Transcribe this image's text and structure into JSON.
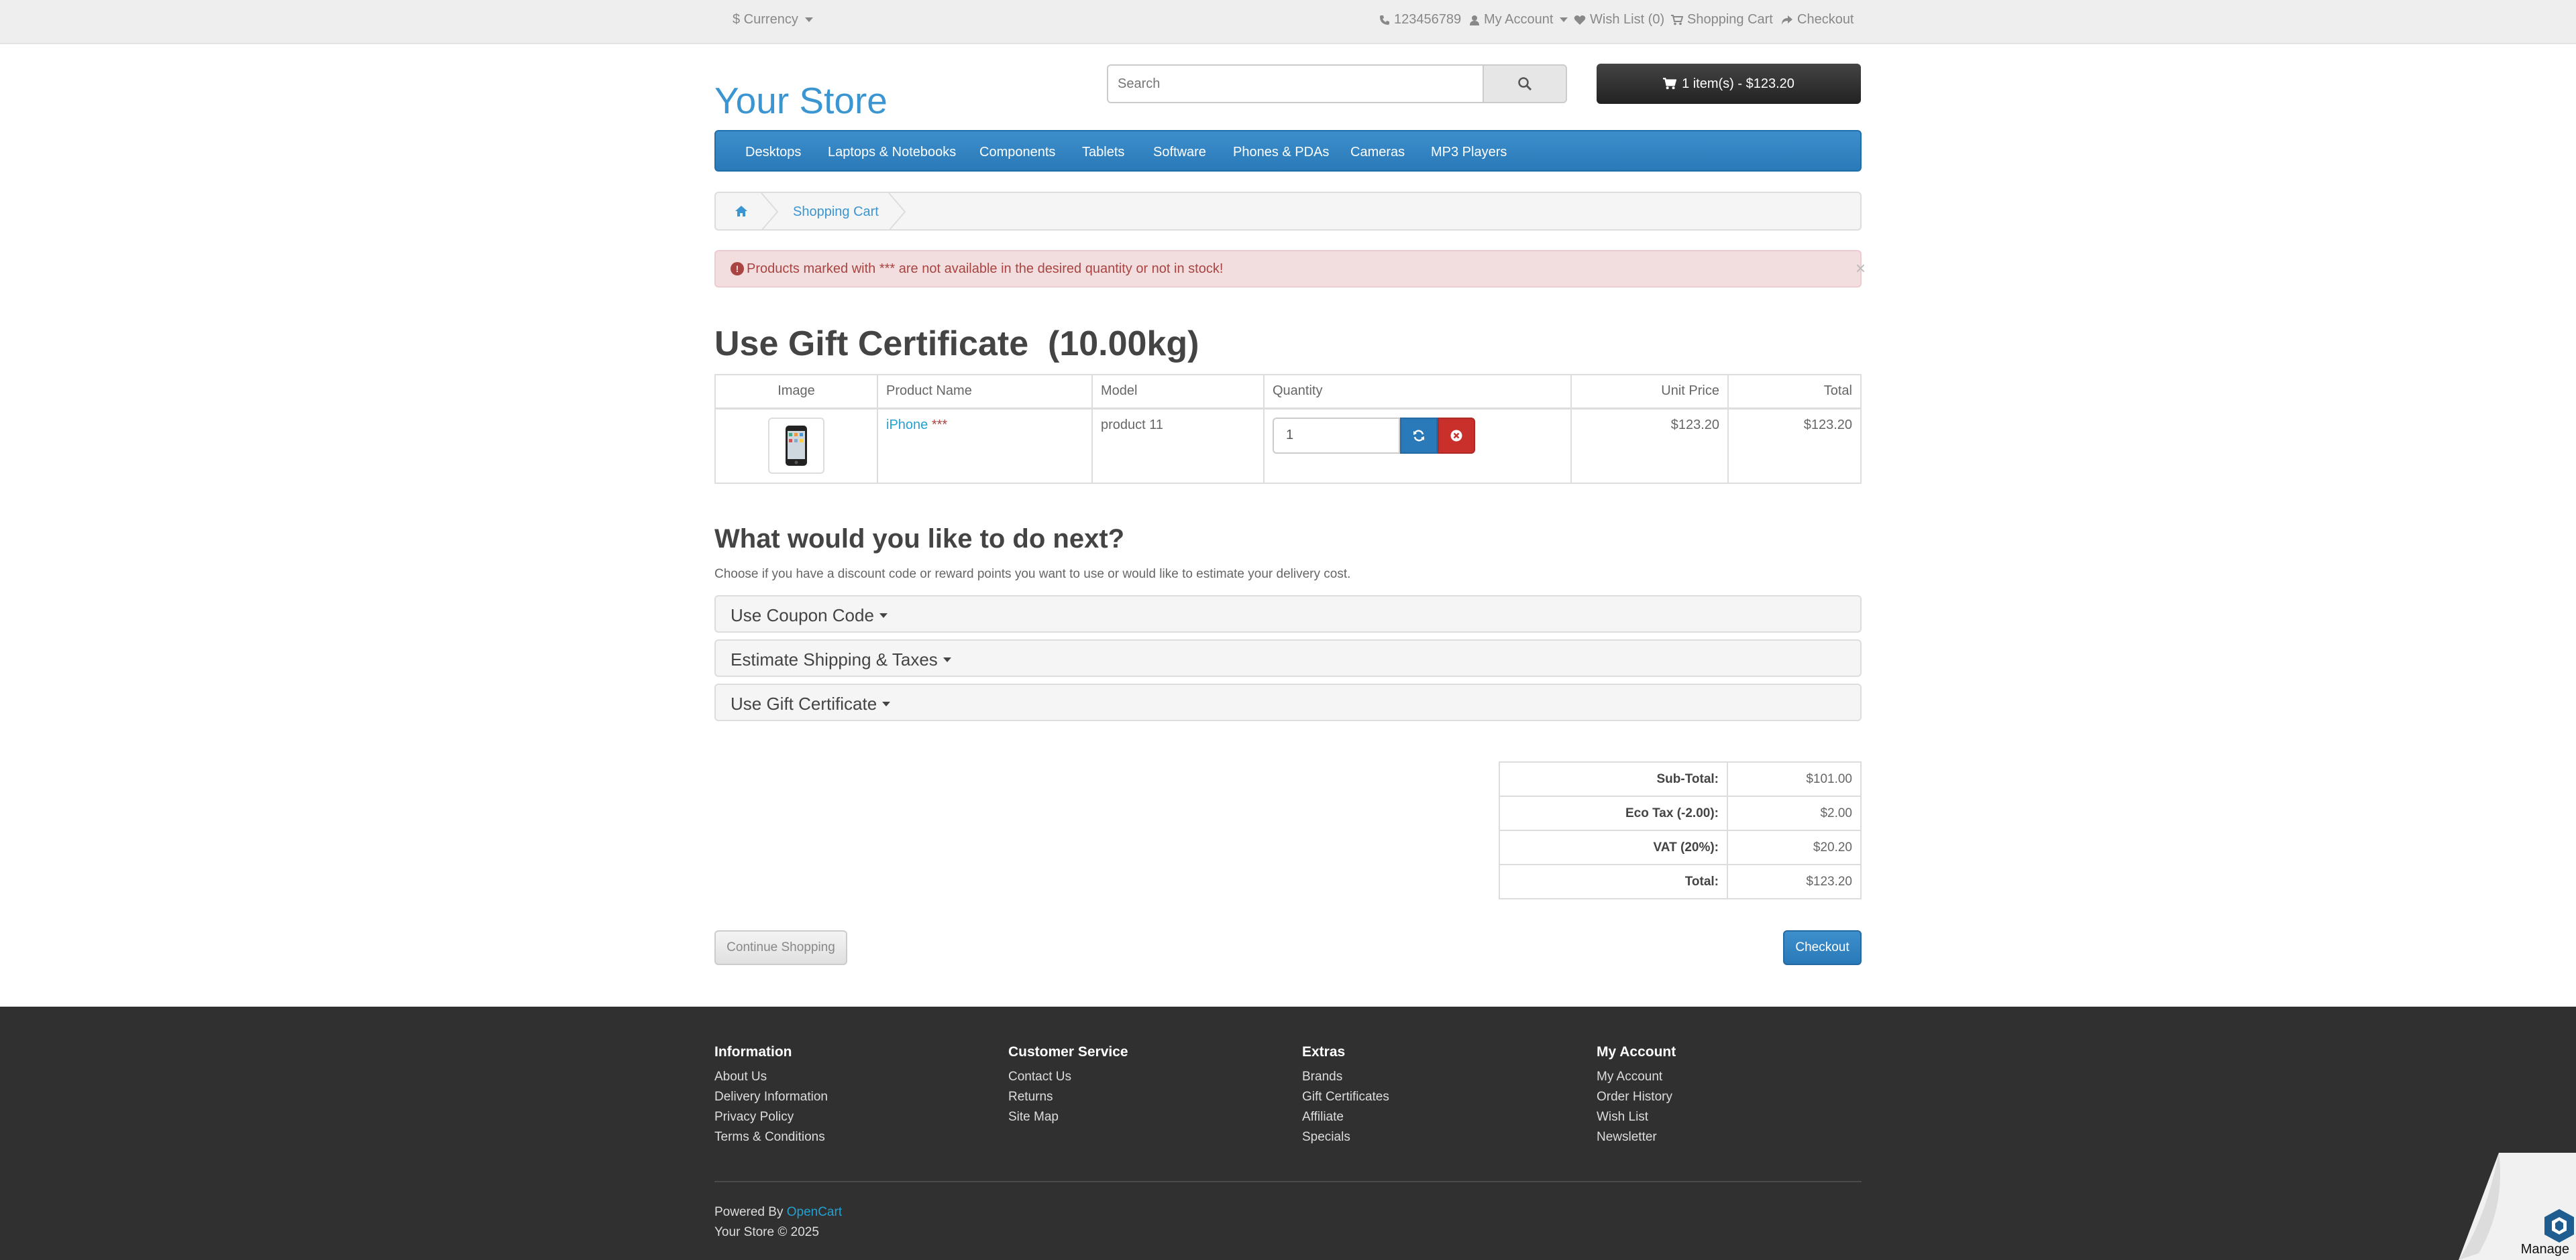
{
  "colors": {
    "link": "#23a1d1",
    "menu": "#2a79b8",
    "alert_bg": "#f2dede",
    "alert_text": "#a94442",
    "footer_bg": "#303030"
  },
  "top": {
    "currency": "$ Currency",
    "phone": "123456789",
    "my_account": "My Account",
    "wishlist": "Wish List (0)",
    "shopping_cart": "Shopping Cart",
    "checkout": "Checkout"
  },
  "header": {
    "logo": "Your Store",
    "search_placeholder": "Search",
    "cart_button": "1 item(s) - $123.20"
  },
  "menu": [
    "Desktops",
    "Laptops & Notebooks",
    "Components",
    "Tablets",
    "Software",
    "Phones & PDAs",
    "Cameras",
    "MP3 Players"
  ],
  "breadcrumb": {
    "current": "Shopping Cart"
  },
  "alert": {
    "text": "Products marked with *** are not available in the desired quantity or not in stock!",
    "close": "×"
  },
  "page": {
    "title": "Use Gift Certificate  (10.00kg)"
  },
  "cart_table": {
    "headers": [
      "Image",
      "Product Name",
      "Model",
      "Quantity",
      "Unit Price",
      "Total"
    ],
    "rows": [
      {
        "name": "iPhone",
        "stock_mark": "***",
        "model": "product 11",
        "quantity": "1",
        "unit_price": "$123.20",
        "total": "$123.20"
      }
    ]
  },
  "next": {
    "title": "What would you like to do next?",
    "description": "Choose if you have a discount code or reward points you want to use or would like to estimate your delivery cost.",
    "panels": [
      "Use Coupon Code",
      "Estimate Shipping & Taxes",
      "Use Gift Certificate"
    ]
  },
  "totals": [
    {
      "label": "Sub-Total:",
      "value": "$101.00"
    },
    {
      "label": "Eco Tax (-2.00):",
      "value": "$2.00"
    },
    {
      "label": "VAT (20%):",
      "value": "$20.20"
    },
    {
      "label": "Total:",
      "value": "$123.20"
    }
  ],
  "buttons": {
    "continue": "Continue Shopping",
    "checkout": "Checkout"
  },
  "footer": {
    "columns": [
      {
        "title": "Information",
        "links": [
          "About Us",
          "Delivery Information",
          "Privacy Policy",
          "Terms & Conditions"
        ]
      },
      {
        "title": "Customer Service",
        "links": [
          "Contact Us",
          "Returns",
          "Site Map"
        ]
      },
      {
        "title": "Extras",
        "links": [
          "Brands",
          "Gift Certificates",
          "Affiliate",
          "Specials"
        ]
      },
      {
        "title": "My Account",
        "links": [
          "My Account",
          "Order History",
          "Wish List",
          "Newsletter"
        ]
      }
    ],
    "powered_prefix": "Powered By",
    "powered_link": "OpenCart",
    "copyright": "Your Store © 2025"
  },
  "widget": {
    "label": "Manage"
  }
}
